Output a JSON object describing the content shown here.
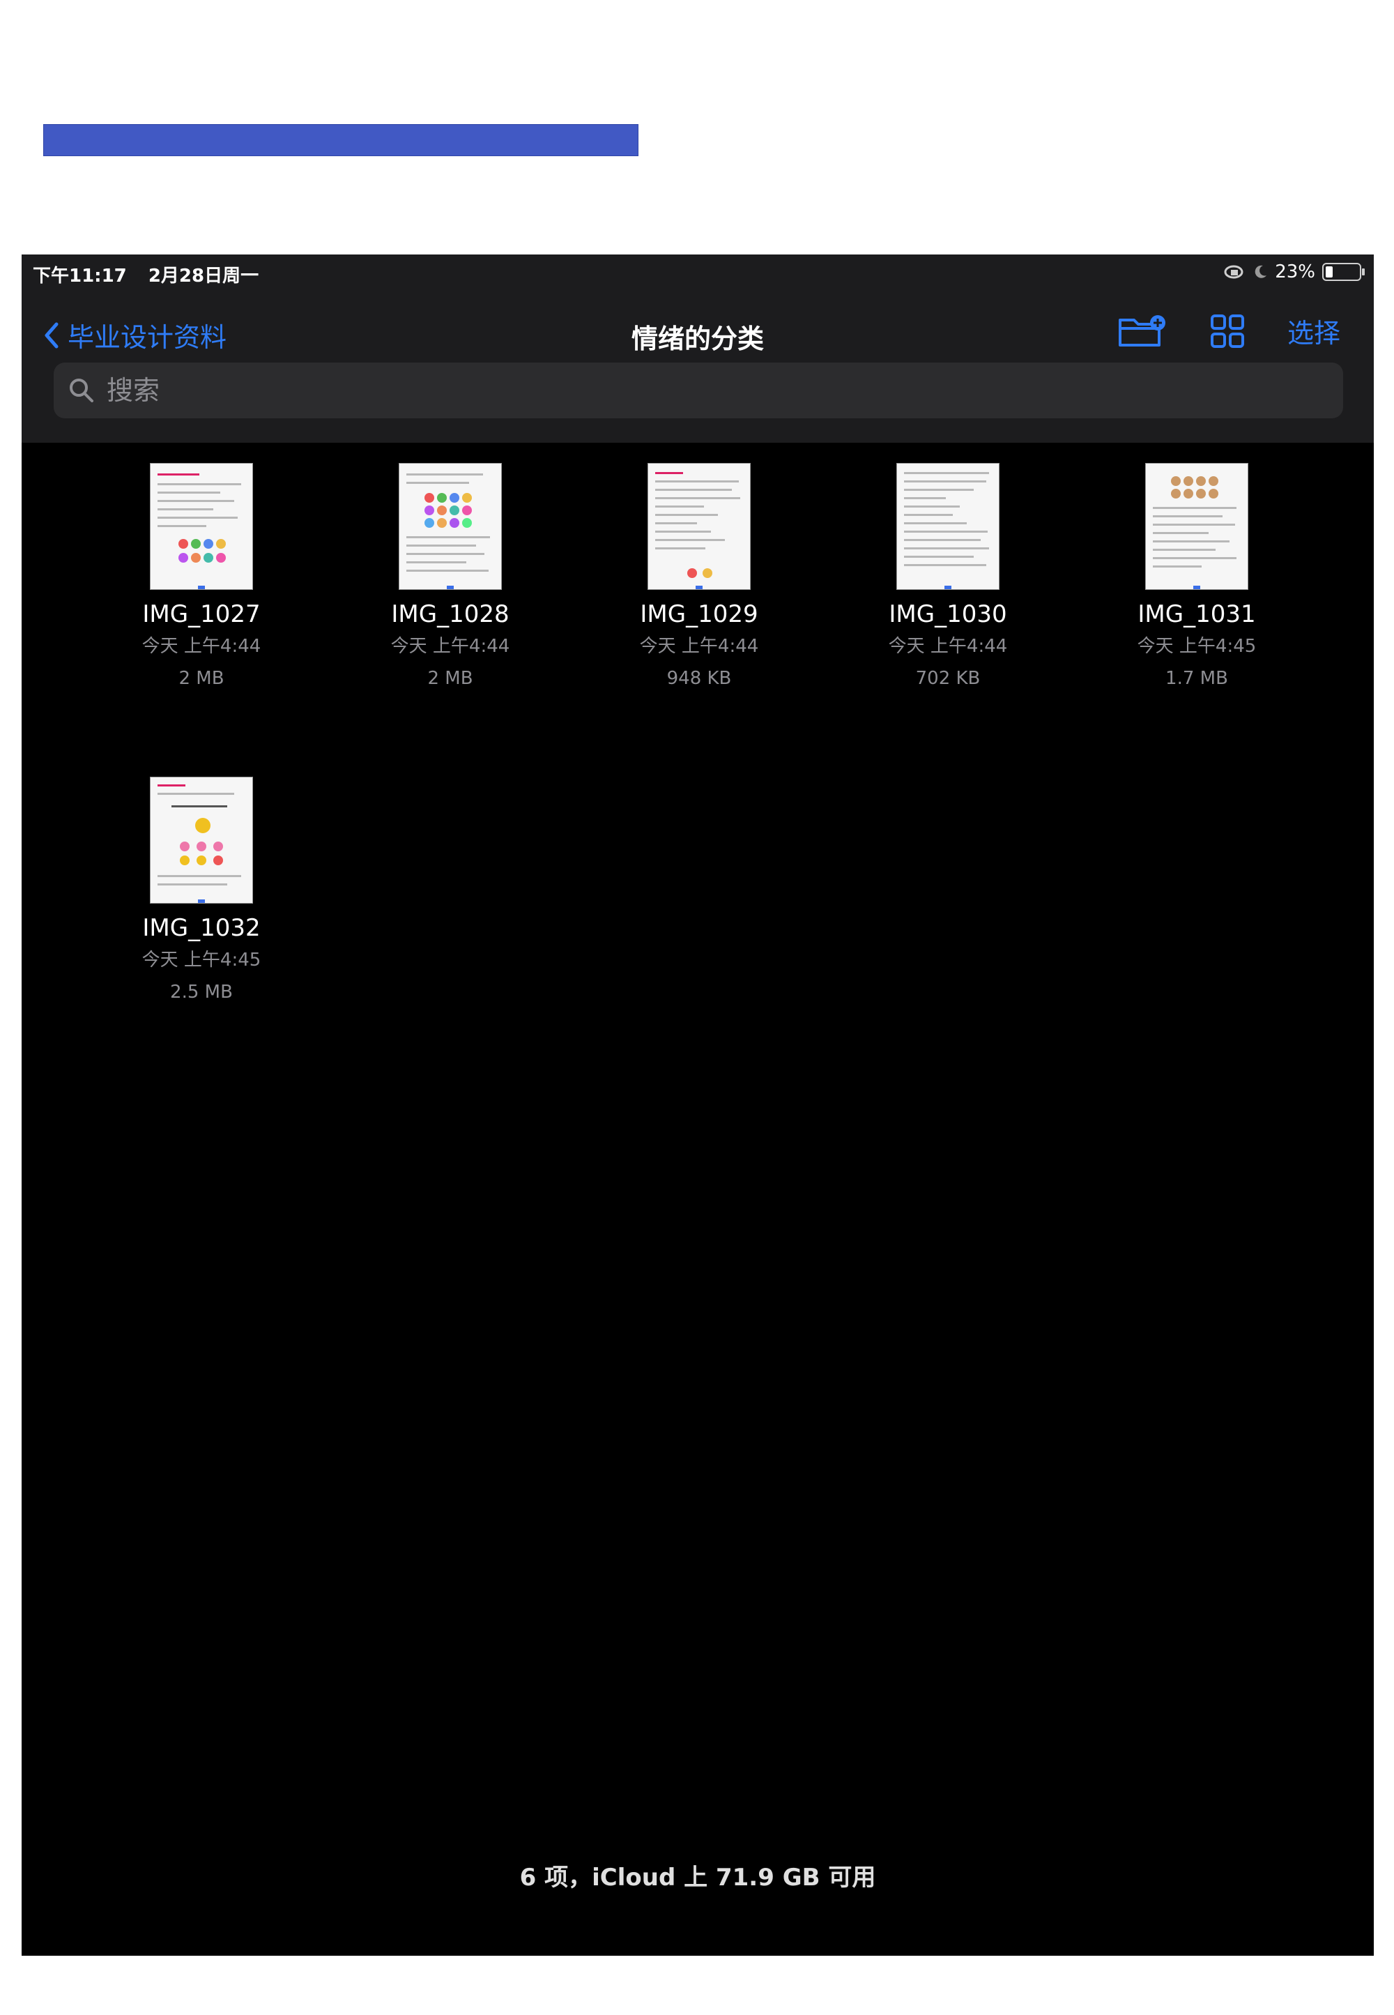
{
  "status": {
    "time": "下午11:17",
    "date": "2月28日周一",
    "battery": "23%"
  },
  "nav": {
    "back_label": "毕业设计资料",
    "title": "情绪的分类",
    "select_label": "选择"
  },
  "search": {
    "placeholder": "搜索"
  },
  "files": [
    {
      "name": "IMG_1027",
      "date": "今天 上午4:44",
      "size": "2 MB"
    },
    {
      "name": "IMG_1028",
      "date": "今天 上午4:44",
      "size": "2 MB"
    },
    {
      "name": "IMG_1029",
      "date": "今天 上午4:44",
      "size": "948 KB"
    },
    {
      "name": "IMG_1030",
      "date": "今天 上午4:44",
      "size": "702 KB"
    },
    {
      "name": "IMG_1031",
      "date": "今天 上午4:45",
      "size": "1.7 MB"
    },
    {
      "name": "IMG_1032",
      "date": "今天 上午4:45",
      "size": "2.5 MB"
    }
  ],
  "footer": {
    "summary": "6 项，iCloud 上 71.9 GB 可用"
  },
  "colors": {
    "accent": "#2f7cf6",
    "header_bg": "#1c1c1e",
    "screen_bg": "#000000",
    "banner": "#4159c4"
  }
}
